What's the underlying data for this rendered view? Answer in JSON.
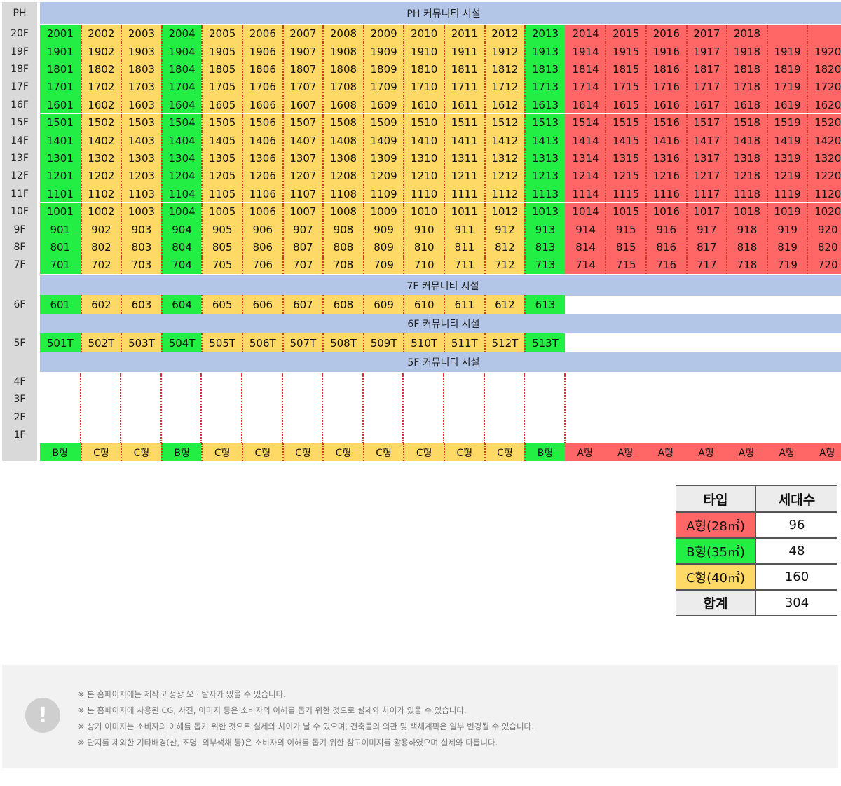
{
  "floors": {
    "ph_label": "PH",
    "labels": [
      "20F",
      "19F",
      "18F",
      "17F",
      "16F",
      "15F",
      "14F",
      "13F",
      "12F",
      "11F",
      "10F",
      "9F",
      "8F",
      "7F",
      "6F",
      "5F",
      "4F",
      "3F",
      "2F",
      "1F"
    ]
  },
  "banners": {
    "ph": "PH 커뮤니티 시설",
    "f7": "7F 커뮤니티 시설",
    "f6": "6F 커뮤니티 시설",
    "f5": "5F 커뮤니티 시설"
  },
  "column_types": [
    "B",
    "C",
    "C",
    "B",
    "C",
    "C",
    "C",
    "C",
    "C",
    "C",
    "C",
    "C",
    "B",
    "A",
    "A",
    "A",
    "A",
    "A",
    "A",
    "A"
  ],
  "type_labels": [
    "B형",
    "C형",
    "C형",
    "B형",
    "C형",
    "C형",
    "C형",
    "C형",
    "C형",
    "C형",
    "C형",
    "C형",
    "B형",
    "A형",
    "A형",
    "A형",
    "A형",
    "A형",
    "A형",
    "A형"
  ],
  "type_colors": {
    "A": "#ff6666",
    "B": "#22ee44",
    "C": "#ffd966"
  },
  "units": {
    "20F": [
      "2001",
      "2002",
      "2003",
      "2004",
      "2005",
      "2006",
      "2007",
      "2008",
      "2009",
      "2010",
      "2011",
      "2012",
      "2013",
      "2014",
      "2015",
      "2016",
      "2017",
      "2018",
      "",
      ""
    ],
    "19F": [
      "1901",
      "1902",
      "1903",
      "1904",
      "1905",
      "1906",
      "1907",
      "1908",
      "1909",
      "1910",
      "1911",
      "1912",
      "1913",
      "1914",
      "1915",
      "1916",
      "1917",
      "1918",
      "1919",
      "1920"
    ],
    "18F": [
      "1801",
      "1802",
      "1803",
      "1804",
      "1805",
      "1806",
      "1807",
      "1808",
      "1809",
      "1810",
      "1811",
      "1812",
      "1813",
      "1814",
      "1815",
      "1816",
      "1817",
      "1818",
      "1819",
      "1820"
    ],
    "17F": [
      "1701",
      "1702",
      "1703",
      "1704",
      "1705",
      "1706",
      "1707",
      "1708",
      "1709",
      "1710",
      "1711",
      "1712",
      "1713",
      "1714",
      "1715",
      "1716",
      "1717",
      "1718",
      "1719",
      "1720"
    ],
    "16F": [
      "1601",
      "1602",
      "1603",
      "1604",
      "1605",
      "1606",
      "1607",
      "1608",
      "1609",
      "1610",
      "1611",
      "1612",
      "1613",
      "1614",
      "1615",
      "1616",
      "1617",
      "1618",
      "1619",
      "1620"
    ],
    "15F": [
      "1501",
      "1502",
      "1503",
      "1504",
      "1505",
      "1506",
      "1507",
      "1508",
      "1509",
      "1510",
      "1511",
      "1512",
      "1513",
      "1514",
      "1515",
      "1516",
      "1517",
      "1518",
      "1519",
      "1520"
    ],
    "14F": [
      "1401",
      "1402",
      "1403",
      "1404",
      "1405",
      "1406",
      "1407",
      "1408",
      "1409",
      "1410",
      "1411",
      "1412",
      "1413",
      "1414",
      "1415",
      "1416",
      "1417",
      "1418",
      "1419",
      "1420"
    ],
    "13F": [
      "1301",
      "1302",
      "1303",
      "1304",
      "1305",
      "1306",
      "1307",
      "1308",
      "1309",
      "1310",
      "1311",
      "1312",
      "1313",
      "1314",
      "1315",
      "1316",
      "1317",
      "1318",
      "1319",
      "1320"
    ],
    "12F": [
      "1201",
      "1202",
      "1203",
      "1204",
      "1205",
      "1206",
      "1207",
      "1208",
      "1209",
      "1210",
      "1211",
      "1212",
      "1213",
      "1214",
      "1215",
      "1216",
      "1217",
      "1218",
      "1219",
      "1220"
    ],
    "11F": [
      "1101",
      "1102",
      "1103",
      "1104",
      "1105",
      "1106",
      "1107",
      "1108",
      "1109",
      "1110",
      "1111",
      "1112",
      "1113",
      "1114",
      "1115",
      "1116",
      "1117",
      "1118",
      "1119",
      "1120"
    ],
    "10F": [
      "1001",
      "1002",
      "1003",
      "1004",
      "1005",
      "1006",
      "1007",
      "1008",
      "1009",
      "1010",
      "1011",
      "1012",
      "1013",
      "1014",
      "1015",
      "1016",
      "1017",
      "1018",
      "1019",
      "1020"
    ],
    "9F": [
      "901",
      "902",
      "903",
      "904",
      "905",
      "906",
      "907",
      "908",
      "909",
      "910",
      "911",
      "912",
      "913",
      "914",
      "915",
      "916",
      "917",
      "918",
      "919",
      "920"
    ],
    "8F": [
      "801",
      "802",
      "803",
      "804",
      "805",
      "806",
      "807",
      "808",
      "809",
      "810",
      "811",
      "812",
      "813",
      "814",
      "815",
      "816",
      "817",
      "818",
      "819",
      "820"
    ],
    "7F": [
      "701",
      "702",
      "703",
      "704",
      "705",
      "706",
      "707",
      "708",
      "709",
      "710",
      "711",
      "712",
      "713",
      "714",
      "715",
      "716",
      "717",
      "718",
      "719",
      "720"
    ],
    "6F": [
      "601",
      "602",
      "603",
      "604",
      "605",
      "606",
      "607",
      "608",
      "609",
      "610",
      "611",
      "612",
      "613"
    ],
    "5F": [
      "501T",
      "502T",
      "503T",
      "504T",
      "505T",
      "506T",
      "507T",
      "508T",
      "509T",
      "510T",
      "511T",
      "512T",
      "513T"
    ]
  },
  "summary": {
    "headers": [
      "타입",
      "세대수"
    ],
    "rows": [
      {
        "type": "A형(28㎡)",
        "count": "96",
        "color": "#ff6666"
      },
      {
        "type": "B형(35㎡)",
        "count": "48",
        "color": "#22ee44"
      },
      {
        "type": "C형(40㎡)",
        "count": "160",
        "color": "#ffd966"
      }
    ],
    "total_label": "합계",
    "total_count": "304"
  },
  "notice": {
    "icon": "exclamation-icon",
    "icon_glyph": "!",
    "lines": [
      "※ 본 홈페이지에는 제작 과정상 오 · 탈자가 있을 수 있습니다.",
      "※ 본 홈페이지에 사용된 CG, 사진, 이미지 등은 소비자의 이해를 돕기 위한 것으로 실제와 차이가 있을 수 있습니다.",
      "※ 상기 이미지는 소비자의 이해를 돕기 위한 것으로 실제와 차이가 날 수 있으며, 건축물의 외관 및 색채계획은 일부 변경될 수 있습니다.",
      "※ 단지를 제외한 기타배경(산, 조명, 외부색채 등)은 소비자의 이해를 돕기 위한 참고이미지를 활용하였으며 실제와 다릅니다."
    ]
  }
}
